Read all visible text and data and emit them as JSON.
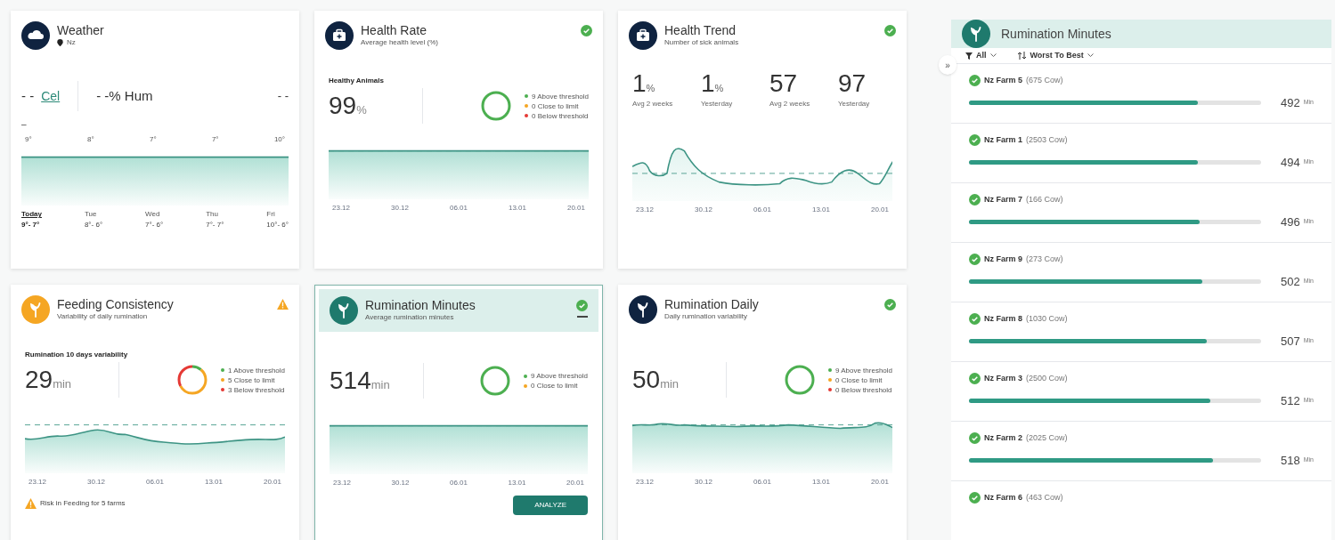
{
  "cards": [
    {
      "kind": "weather",
      "title": "Weather",
      "subtitle": "Nz",
      "color": "#0f2340",
      "selected": false,
      "temp": "- -",
      "unit": "Cel",
      "humidity": "- -% Hum",
      "extra": "- -",
      "dash": "–",
      "temps": [
        "9°",
        "8°",
        "7°",
        "7°",
        "10°"
      ],
      "chart": {
        "kind": "flat"
      },
      "days": [
        {
          "day": "Today",
          "range": "9°- 7°",
          "selected": true
        },
        {
          "day": "Tue",
          "range": "8°- 6°",
          "selected": false
        },
        {
          "day": "Wed",
          "range": "7°- 6°",
          "selected": false
        },
        {
          "day": "Thu",
          "range": "7°- 7°",
          "selected": false
        },
        {
          "day": "Fri",
          "range": "10°- 6°",
          "selected": false
        }
      ]
    },
    {
      "kind": "gauge",
      "title": "Health Rate",
      "subtitle": "Average health level (%)",
      "color": "#0f2340",
      "selected": false,
      "warning": false,
      "label": "Healthy Animals",
      "value": "99",
      "unit": "%",
      "legend": [
        {
          "text": "9 Above threshold",
          "color": "#4caf50",
          "level": 1
        },
        {
          "text": "0 Close to limit",
          "color": "#f5a623",
          "level": 0
        },
        {
          "text": "0 Below threshold",
          "color": "#e53935",
          "level": 0
        }
      ],
      "chart": {
        "kind": "flat",
        "x_labels": [
          "23.12",
          "30.12",
          "06.01",
          "13.01",
          "20.01"
        ]
      }
    },
    {
      "kind": "trend",
      "title": "Health Trend",
      "subtitle": "Number of sick animals",
      "color": "#0f2340",
      "selected": false,
      "warning": false,
      "stats": [
        {
          "value": "1",
          "unit": "%",
          "label": "Avg 2 weeks"
        },
        {
          "value": "1",
          "unit": "%",
          "label": "Yesterday"
        },
        {
          "value": "57",
          "label": "Avg 2 weeks"
        },
        {
          "value": "97",
          "label": "Yesterday"
        }
      ],
      "chart": {
        "kind": "spiky",
        "x_labels": [
          "23.12",
          "30.12",
          "06.01",
          "13.01",
          "20.01"
        ]
      }
    },
    {
      "kind": "gauge",
      "title": "Feeding Consistency",
      "subtitle": "Variability of daily rumination",
      "color": "#f5a623",
      "selected": false,
      "warning": true,
      "label": "Rumination 10 days variability",
      "value": "29",
      "unit": "min",
      "legend": [
        {
          "text": "1 Above threshold",
          "color": "#4caf50",
          "level": 0.11
        },
        {
          "text": "5 Close to limit",
          "color": "#f5a623",
          "level": 0.56
        },
        {
          "text": "3 Below threshold",
          "color": "#e53935",
          "level": 0.33
        }
      ],
      "chart": {
        "kind": "wave",
        "x_labels": [
          "23.12",
          "30.12",
          "06.01",
          "13.01",
          "20.01"
        ]
      },
      "footer": "Risk in Feeding for 5 farms"
    },
    {
      "kind": "gauge",
      "title": "Rumination Minutes",
      "subtitle": "Average rumination minutes",
      "color": "#1f7a6d",
      "selected": true,
      "warning": false,
      "value": "514",
      "unit": "min",
      "legend": [
        {
          "text": "9 Above threshold",
          "color": "#4caf50",
          "level": 1
        },
        {
          "text": "0 Close to limit",
          "color": "#f5a623",
          "level": 0
        }
      ],
      "chart": {
        "kind": "flat",
        "x_labels": [
          "23.12",
          "30.12",
          "06.01",
          "13.01",
          "20.01"
        ]
      },
      "button": "ANALYZE"
    },
    {
      "kind": "gauge",
      "title": "Rumination Daily",
      "subtitle": "Daily rumination variability",
      "color": "#0f2340",
      "selected": false,
      "warning": false,
      "value": "50",
      "unit": "min",
      "legend": [
        {
          "text": "9 Above threshold",
          "color": "#4caf50",
          "level": 1
        },
        {
          "text": "0 Close to limit",
          "color": "#f5a623",
          "level": 0
        },
        {
          "text": "0 Below threshold",
          "color": "#e53935",
          "level": 0
        }
      ],
      "chart": {
        "kind": "ripple",
        "x_labels": [
          "23.12",
          "30.12",
          "06.01",
          "13.01",
          "20.01"
        ]
      }
    }
  ],
  "panel": {
    "title": "Rumination Minutes",
    "collapse": "»",
    "filters": [
      {
        "kind": "filter",
        "label": "All"
      },
      {
        "kind": "sort",
        "label": "Worst To Best"
      }
    ],
    "rows": [
      {
        "name": "Nz Farm 5",
        "count": "(675 Cow)",
        "value": "492",
        "unit": "Min",
        "level": 0.77
      },
      {
        "name": "Nz Farm 1",
        "count": "(2503 Cow)",
        "value": "494",
        "unit": "Min",
        "level": 0.77
      },
      {
        "name": "Nz Farm 7",
        "count": "(166 Cow)",
        "value": "496",
        "unit": "Min",
        "level": 0.775
      },
      {
        "name": "Nz Farm 9",
        "count": "(273 Cow)",
        "value": "502",
        "unit": "Min",
        "level": 0.785
      },
      {
        "name": "Nz Farm 8",
        "count": "(1030 Cow)",
        "value": "507",
        "unit": "Min",
        "level": 0.8
      },
      {
        "name": "Nz Farm 3",
        "count": "(2500 Cow)",
        "value": "512",
        "unit": "Min",
        "level": 0.81
      },
      {
        "name": "Nz Farm 2",
        "count": "(2025 Cow)",
        "value": "518",
        "unit": "Min",
        "level": 0.82
      },
      {
        "name": "Nz Farm 6",
        "count": "(463 Cow)"
      }
    ]
  }
}
